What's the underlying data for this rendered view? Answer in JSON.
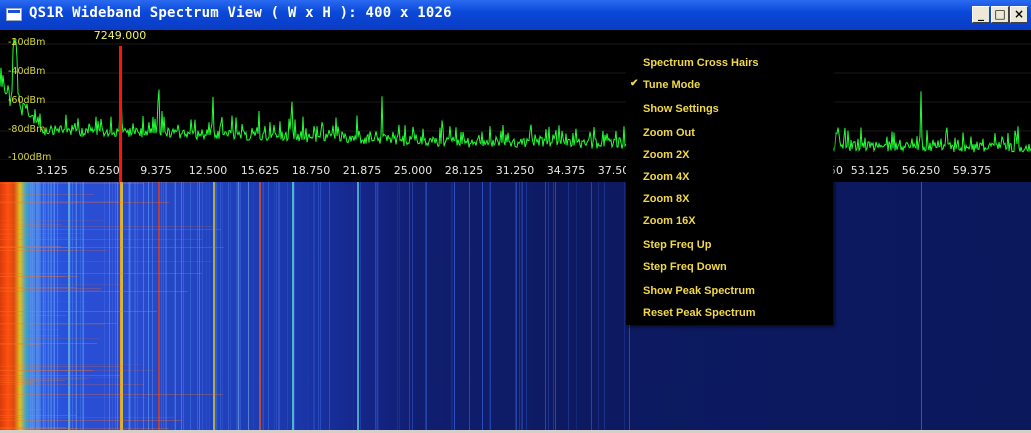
{
  "window": {
    "title": "QS1R Wideband Spectrum View ( W x H ): 400 x 1026",
    "buttons": {
      "minimize": "_",
      "maximize": "□",
      "close": "×"
    }
  },
  "spectrum": {
    "trace_color": "#22ff33",
    "y_labels": [
      "-20dBm",
      "-40dBm",
      "-60dBm",
      "-80dBm",
      "-100dBm"
    ],
    "x_labels": [
      "3.125",
      "6.250",
      "9.375",
      "12.500",
      "15.625",
      "18.750",
      "21.875",
      "25.000",
      "28.125",
      "31.250",
      "34.375",
      "37.500",
      "",
      "",
      "",
      "",
      "50",
      "53.125",
      "56.250",
      "59.375"
    ],
    "marker": {
      "label": "7249.000",
      "color": "#ff1010"
    }
  },
  "context_menu": {
    "checked_item": "Tune Mode",
    "items": [
      "Spectrum Cross Hairs",
      "Tune Mode",
      "Show Settings",
      "Zoom Out",
      "Zoom 2X",
      "Zoom 4X",
      "Zoom 8X",
      "Zoom 16X",
      "Step Freq Up",
      "Step Freq Down",
      "Show Peak Spectrum",
      "Reset Peak Spectrum"
    ]
  },
  "colors": {
    "menu_text": "#f2d84a",
    "title_bar": "#0a48d8",
    "waterfall_bg": "#0b185c"
  }
}
